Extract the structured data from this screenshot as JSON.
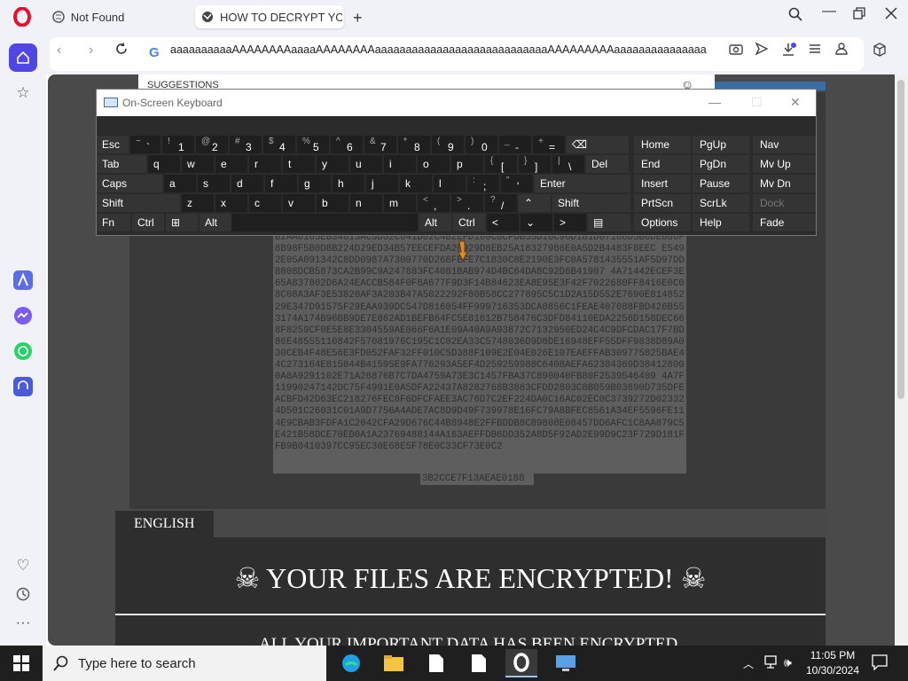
{
  "browser": {
    "tabs": [
      {
        "label": "Not Found"
      },
      {
        "label": "HOW TO DECRYPT YOUR FILES"
      }
    ],
    "new_tab": "+",
    "url": "aaaaaaaaaaAAAAAAAAaaaaAAAAAAAAaaaaaaaaaaaaaaaaaaaaaaaaaaaaAAAAAAAAAaaaaaaaaaaaaaaaaaaa",
    "suggestions_label": "SUGGESTIONS"
  },
  "keyboard": {
    "title": "On-Screen Keyboard",
    "rows": [
      [
        {
          "u": "",
          "d": "Esc"
        },
        {
          "u": "~",
          "d": "`"
        },
        {
          "u": "!",
          "d": "1"
        },
        {
          "u": "@",
          "d": "2"
        },
        {
          "u": "#",
          "d": "3"
        },
        {
          "u": "$",
          "d": "4"
        },
        {
          "u": "%",
          "d": "5"
        },
        {
          "u": "^",
          "d": "6"
        },
        {
          "u": "&",
          "d": "7"
        },
        {
          "u": "*",
          "d": "8"
        },
        {
          "u": "(",
          "d": "9"
        },
        {
          "u": ")",
          "d": "0"
        },
        {
          "u": "_",
          "d": "-"
        },
        {
          "u": "+",
          "d": "="
        },
        {
          "u": "",
          "d": "⌫"
        },
        {
          "u": "",
          "d": "Home"
        },
        {
          "u": "",
          "d": "PgUp"
        },
        {
          "u": "",
          "d": "Nav"
        }
      ],
      [
        {
          "u": "",
          "d": "Tab"
        },
        {
          "u": "",
          "d": "q"
        },
        {
          "u": "",
          "d": "w"
        },
        {
          "u": "",
          "d": "e"
        },
        {
          "u": "",
          "d": "r"
        },
        {
          "u": "",
          "d": "t"
        },
        {
          "u": "",
          "d": "y"
        },
        {
          "u": "",
          "d": "u"
        },
        {
          "u": "",
          "d": "i"
        },
        {
          "u": "",
          "d": "o"
        },
        {
          "u": "",
          "d": "p"
        },
        {
          "u": "{",
          "d": "["
        },
        {
          "u": "}",
          "d": "]"
        },
        {
          "u": "|",
          "d": "\\"
        },
        {
          "u": "",
          "d": "Del"
        },
        {
          "u": "",
          "d": "End"
        },
        {
          "u": "",
          "d": "PgDn"
        },
        {
          "u": "",
          "d": "Mv Up"
        }
      ],
      [
        {
          "u": "",
          "d": "Caps"
        },
        {
          "u": "",
          "d": "a"
        },
        {
          "u": "",
          "d": "s"
        },
        {
          "u": "",
          "d": "d"
        },
        {
          "u": "",
          "d": "f"
        },
        {
          "u": "",
          "d": "g"
        },
        {
          "u": "",
          "d": "h"
        },
        {
          "u": "",
          "d": "j"
        },
        {
          "u": "",
          "d": "k"
        },
        {
          "u": "",
          "d": "l"
        },
        {
          "u": ":",
          "d": ";"
        },
        {
          "u": "\"",
          "d": "'"
        },
        {
          "u": "",
          "d": "Enter"
        },
        {
          "u": "",
          "d": "Insert"
        },
        {
          "u": "",
          "d": "Pause"
        },
        {
          "u": "",
          "d": "Mv Dn"
        }
      ],
      [
        {
          "u": "",
          "d": "Shift"
        },
        {
          "u": "",
          "d": "z"
        },
        {
          "u": "",
          "d": "x"
        },
        {
          "u": "",
          "d": "c"
        },
        {
          "u": "",
          "d": "v"
        },
        {
          "u": "",
          "d": "b"
        },
        {
          "u": "",
          "d": "n"
        },
        {
          "u": "",
          "d": "m"
        },
        {
          "u": "<",
          "d": ","
        },
        {
          "u": ">",
          "d": "."
        },
        {
          "u": "?",
          "d": "/"
        },
        {
          "u": "",
          "d": "⌃"
        },
        {
          "u": "",
          "d": "Shift"
        },
        {
          "u": "",
          "d": "PrtScn"
        },
        {
          "u": "",
          "d": "ScrLk"
        },
        {
          "u": "",
          "d": "Dock"
        }
      ],
      [
        {
          "u": "",
          "d": "Fn"
        },
        {
          "u": "",
          "d": "Ctrl"
        },
        {
          "u": "",
          "d": "⊞"
        },
        {
          "u": "",
          "d": "Alt"
        },
        {
          "u": "",
          "d": ""
        },
        {
          "u": "",
          "d": "Alt"
        },
        {
          "u": "",
          "d": "Ctrl"
        },
        {
          "u": "",
          "d": "<"
        },
        {
          "u": "",
          "d": "⌄"
        },
        {
          "u": "",
          "d": ">"
        },
        {
          "u": "",
          "d": "▤"
        },
        {
          "u": "",
          "d": "Options"
        },
        {
          "u": "",
          "d": "Help"
        },
        {
          "u": "",
          "d": "Fade"
        }
      ]
    ]
  },
  "ransom": {
    "hex": "B2AA6165EB34813AC5D32C641D82C4B2EFD180C8CFDB55D18C96D181D67188D5B8DE686F8B98F5B0D8B224D29ED34B57EECEFDA2F929D8EB25A18327986E0A5D2B4483F8EEC E5492E05A091342C8DD0987A7300770D268FEFE7C1830C8E2190E3FC0A5781435551AF5D97DDB808DCB5873CA2B99C9A247883FC4081BAB974D4BC64DA8C92D6B41907 4A71442ECEF3E65A837802D6A24EACCB584F0F8A677F9D3F14B84623EA8E95E3F42F7022680FF8416E0C08C08A3AF3E53820AF3A203B47A5022292F80B58CC277895C5C1D2A15D552E7690E81485229E347D91575F29EAA939DC547D816054FF999716353DCA0856C1FEAE407088FBD426B553174A174B96BB9DE7E862AD1BEFB64FC5E81612B758476C3DFD84110EDA2256D158DEC668F8259CF0E5E8E3304559AE066F6A1E09A40A9A93872C7132950ED24C4C9DFCDAC17F7BD86E48555110842F57081976C195C1C02EA33C5748036D9D8DE16948EFF55DFF9838D89A030CEB4F48E56E3FD052FAF32FF010C5D388F109E2E04E026E107EAEFFAB309775825BAE44C273164E815044B41595E9FA776293A5EF4D259259988C6408AEFA62384369D384128000A8A9291102E71A26876B7C7DA4759A73E3C1457FBA37C890040FB80F2539546409 4A7F11990247142DC75F4991E0A5DFA22437A8282768B3863CFDD2803C8B059B03690D735DFEACBFD42D63EC218276FEC8F6DFCFAEE3AC76D7C2EF224DA0C16AC02EC0C3739272D023324D501C26031C01A9D7756A4ADE7AC8D9D49F739978E16FC79A8BFEC8561A34EF5596FE114E9CBAB3FDFA1C2042CFA29D676C44B8948E2FFBDDB8C89808E08457DD6AFC1C8AA879C5E421B58DCE70ED0A1A23769488144A163AEFFDB6DD352A8D5F92AD2E99D9C23F729D181FFB9B0410397CC95EC30E68E5F78E0C33CF73E0C2",
    "hex_last": "3B2CCE7F13AEAE0188",
    "language_tab": "ENGLISH",
    "headline": "☠ YOUR FILES ARE ENCRYPTED! ☠",
    "subline": "ALL YOUR IMPORTANT DATA HAS BEEN ENCRYPTED."
  },
  "taskbar": {
    "search_placeholder": "Type here to search",
    "time": "11:05 PM",
    "date": "10/30/2024"
  },
  "colors": {
    "opera_red": "#e8112d",
    "accent": "#5046e5",
    "page_bg": "#4a4a4a"
  }
}
